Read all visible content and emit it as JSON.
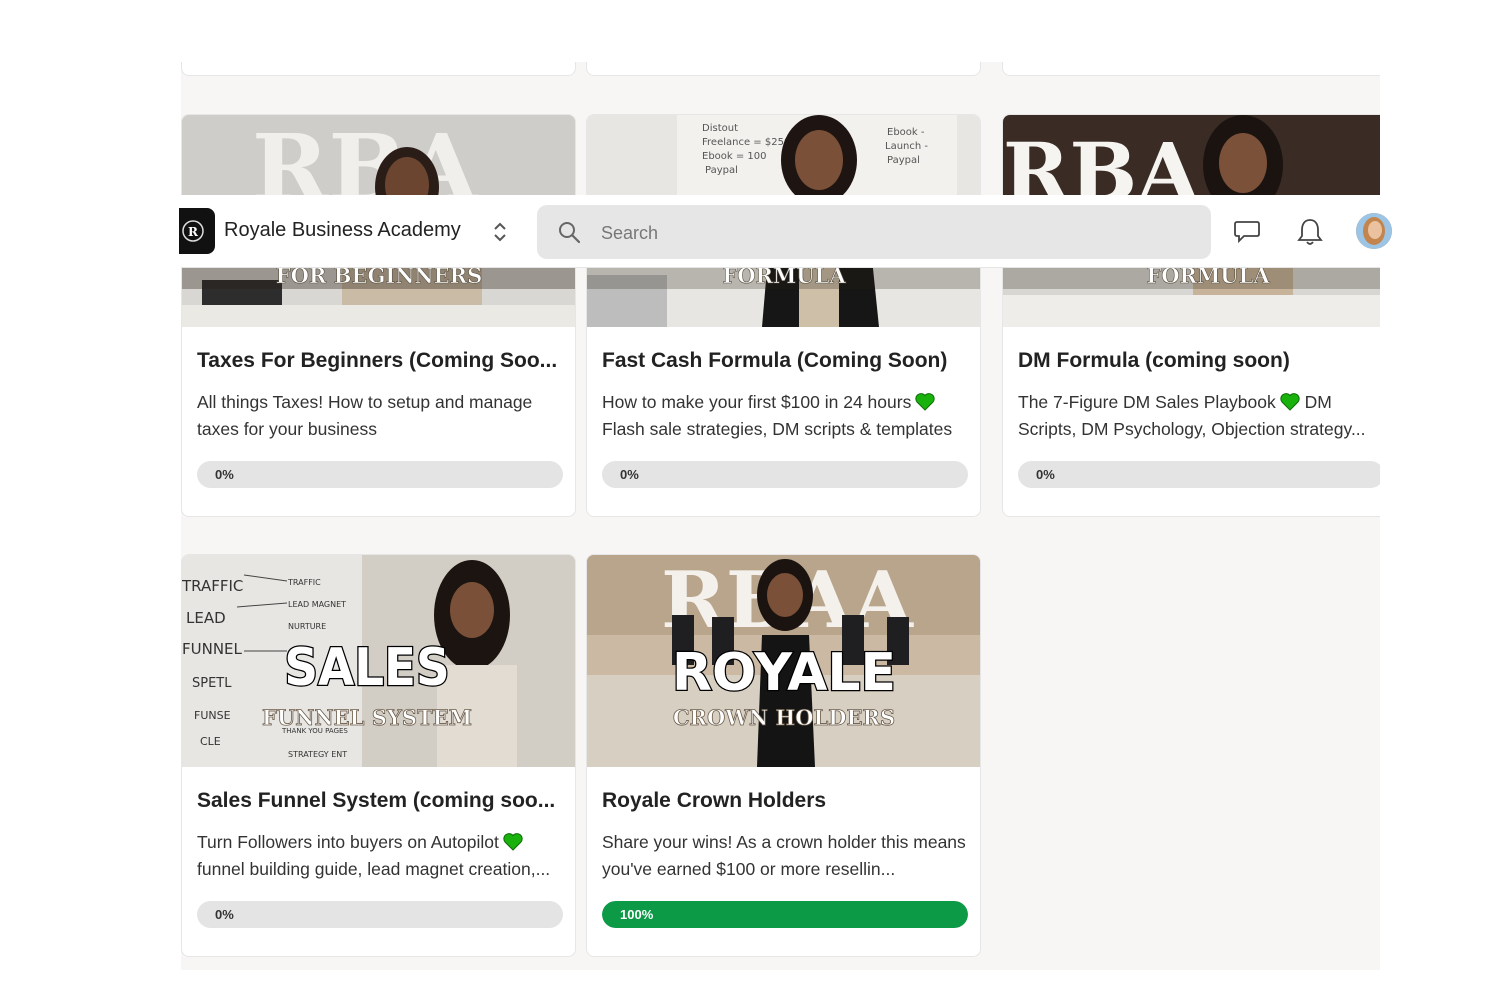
{
  "topbar": {
    "group_name": "Royale Business Academy",
    "logo_letter": "R",
    "search_placeholder": "Search"
  },
  "cards": [
    {
      "thumb_top": "RBA",
      "thumb_banner": "FOR BEGINNERS",
      "title": "Taxes For Beginners (Coming Soo...",
      "description": "All things Taxes! How to setup and manage taxes for your business",
      "progress_label": "0%",
      "progress": 0
    },
    {
      "thumb_board_left": [
        "Distout",
        "Freelance = $250",
        "Ebook = 100",
        "Paypal"
      ],
      "thumb_board_right": [
        "Ebook -",
        "Launch -",
        "Paypal"
      ],
      "thumb_banner": "FORMULA",
      "title": "Fast Cash Formula (Coming Soon)",
      "description_line1": "How to make your first $100 in 24 hours",
      "description_line2": "Flash sale strategies, DM scripts & templates",
      "progress_label": "0%",
      "progress": 0
    },
    {
      "thumb_top": "RBA",
      "thumb_banner": "FORMULA",
      "title": "DM Formula (coming soon)",
      "description_line1": "The 7-Figure DM Sales Playbook",
      "description_line2": "DM Scripts, DM Psychology, Objection strategy...",
      "progress_label": "0%",
      "progress": 0
    },
    {
      "thumb_funnel_left": [
        "TRAFFIC",
        "LEAD",
        "FUNNEL",
        "SPETL",
        "FUNSE",
        "CLE"
      ],
      "thumb_funnel_right": [
        "TRAFFIC",
        "LEAD MAGNET",
        "NURTURE",
        "THANK YOU PAGES",
        "STRATEGY ENT"
      ],
      "thumb_big": "SALES",
      "thumb_banner": "FUNNEL SYSTEM",
      "title": "Sales Funnel System (coming soo...",
      "description_line1": "Turn Followers into buyers on Autopilot",
      "description_line2": "funnel building guide, lead magnet creation,...",
      "progress_label": "0%",
      "progress": 0
    },
    {
      "thumb_top": "RBAA",
      "thumb_big": "ROYALE",
      "thumb_banner": "CROWN HOLDERS",
      "title": "Royale Crown Holders",
      "description": "Share your wins! As a crown holder this means you've earned $100 or more resellin...",
      "progress_label": "100%",
      "progress": 100
    }
  ],
  "colors": {
    "progress_complete": "#0c9a47",
    "progress_track": "#e4e4e4",
    "heart": "#19b10c"
  }
}
